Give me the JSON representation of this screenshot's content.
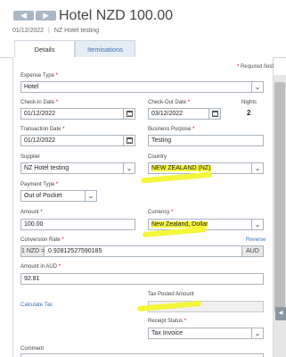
{
  "header": {
    "title": "Hotel NZD 100.00",
    "date": "01/12/2022",
    "subtitle": "NZ Hotel testing",
    "prev_icon": "chevron-left-icon",
    "next_icon": "chevron-right-icon"
  },
  "tabs": [
    {
      "label": "Details",
      "active": true
    },
    {
      "label": "Itemisations",
      "active": false
    }
  ],
  "required_note": "Required field",
  "form": {
    "expense_type": {
      "label": "Expense Type",
      "value": "Hotel"
    },
    "check_in": {
      "label": "Check-in Date",
      "value": "01/12/2022"
    },
    "check_out": {
      "label": "Check-Out Date",
      "value": "03/12/2022"
    },
    "nights": {
      "label": "Nights",
      "value": "2"
    },
    "transaction_date": {
      "label": "Transaction Date",
      "value": "01/12/2022"
    },
    "business_purpose": {
      "label": "Business Purpose",
      "value": "Testing"
    },
    "supplier": {
      "label": "Supplier",
      "value": "NZ Hotel testing"
    },
    "country": {
      "label": "Country",
      "value": "NEW ZEALAND (NZ)"
    },
    "payment_type": {
      "label": "Payment Type",
      "value": "Out of Pocket"
    },
    "amount": {
      "label": "Amount",
      "value": "100.00"
    },
    "currency": {
      "label": "Currency",
      "value": "New Zealand, Dollar"
    },
    "conversion_rate": {
      "label": "Conversion Rate",
      "reverse_link": "Reverse",
      "prefix": "1 NZD =",
      "value": "0.92812527590185",
      "suffix": "AUD"
    },
    "amount_aud": {
      "label": "Amount in AUD",
      "value": "92.81"
    },
    "calculate_tax_link": "Calculate Tax",
    "tax_posted": {
      "label": "Tax Posted Amount",
      "value": ""
    },
    "receipt_status": {
      "label": "Receipt Status",
      "value": "Tax Invoice"
    },
    "comment": {
      "label": "Comment"
    }
  },
  "highlight_color": "#f5f53a"
}
